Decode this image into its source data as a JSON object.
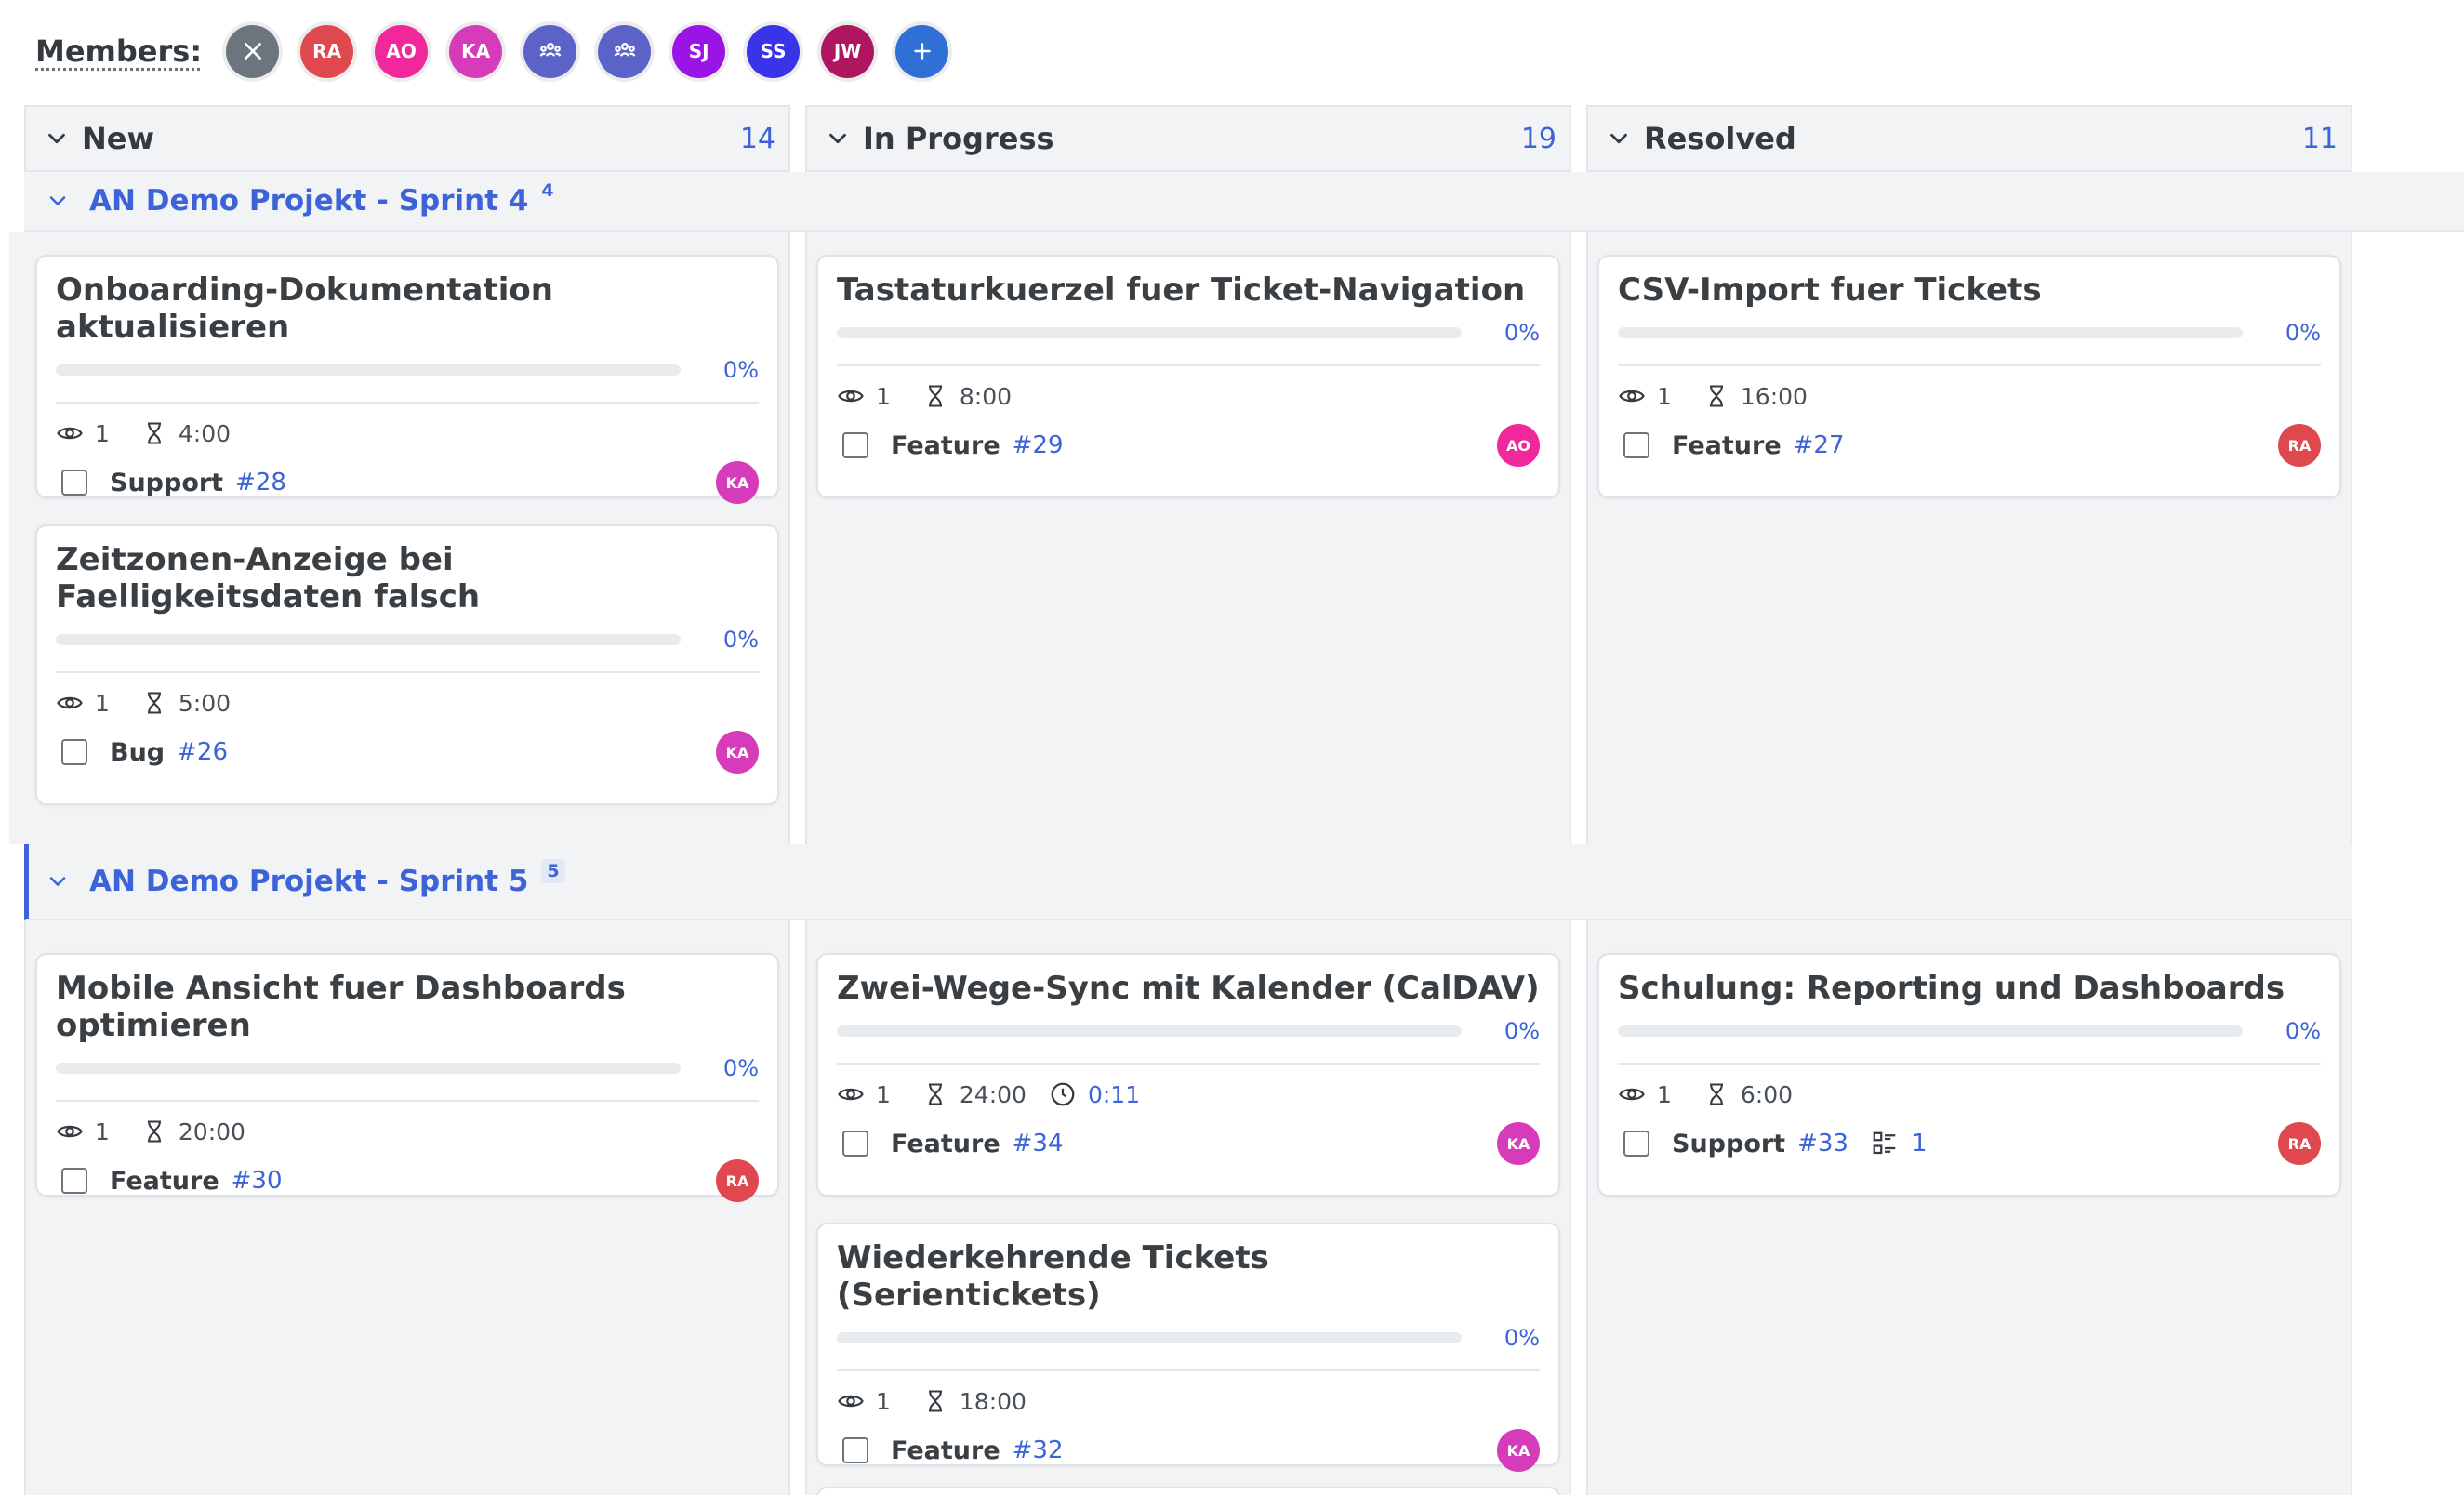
{
  "members": {
    "label": "Members:",
    "avatars": [
      {
        "initials": "",
        "icon": "close-icon",
        "color": "#6c757d"
      },
      {
        "initials": "RA",
        "color": "#e0484f"
      },
      {
        "initials": "AO",
        "color": "#f0289c"
      },
      {
        "initials": "KA",
        "color": "#d63bb9"
      },
      {
        "initials": "",
        "icon": "group-icon",
        "color": "#5b63c9"
      },
      {
        "initials": "",
        "icon": "group-icon",
        "color": "#5b63c9"
      },
      {
        "initials": "SJ",
        "color": "#9b14e6"
      },
      {
        "initials": "SS",
        "color": "#3a34e8"
      },
      {
        "initials": "JW",
        "color": "#b0155f"
      },
      {
        "initials": "",
        "icon": "plus-icon",
        "color": "#2f6fd6"
      }
    ]
  },
  "columns": [
    {
      "title": "New",
      "count": "14"
    },
    {
      "title": "In Progress",
      "count": "19"
    },
    {
      "title": "Resolved",
      "count": "11"
    }
  ],
  "swimlanes": [
    {
      "title": "AN Demo Projekt - Sprint 4",
      "count": "4"
    },
    {
      "title": "AN Demo Projekt - Sprint 5",
      "count": "5"
    }
  ],
  "cards": {
    "c28": {
      "title": "Onboarding-Dokumentation aktualisieren",
      "progress": 0,
      "progress_label": "0%",
      "watchers": "1",
      "estimate": "4:00",
      "type": "Support",
      "id": "#28",
      "assignee": "KA",
      "assignee_color": "#d63bb9"
    },
    "c26": {
      "title": "Zeitzonen-Anzeige bei Faelligkeitsdaten falsch",
      "progress": 0,
      "progress_label": "0%",
      "watchers": "1",
      "estimate": "5:00",
      "type": "Bug",
      "id": "#26",
      "assignee": "KA",
      "assignee_color": "#d63bb9"
    },
    "c29": {
      "title": "Tastaturkuerzel fuer Ticket-Navigation",
      "progress": 0,
      "progress_label": "0%",
      "watchers": "1",
      "estimate": "8:00",
      "type": "Feature",
      "id": "#29",
      "assignee": "AO",
      "assignee_color": "#f0289c"
    },
    "c27": {
      "title": "CSV-Import fuer Tickets",
      "progress": 0,
      "progress_label": "0%",
      "watchers": "1",
      "estimate": "16:00",
      "type": "Feature",
      "id": "#27",
      "assignee": "RA",
      "assignee_color": "#e0484f"
    },
    "c30": {
      "title": "Mobile Ansicht fuer Dashboards optimieren",
      "progress": 0,
      "progress_label": "0%",
      "watchers": "1",
      "estimate": "20:00",
      "type": "Feature",
      "id": "#30",
      "assignee": "RA",
      "assignee_color": "#e0484f"
    },
    "c34": {
      "title": "Zwei-Wege-Sync mit Kalender (CalDAV)",
      "progress": 0,
      "progress_label": "0%",
      "watchers": "1",
      "estimate": "24:00",
      "time_spent": "0:11",
      "type": "Feature",
      "id": "#34",
      "assignee": "KA",
      "assignee_color": "#d63bb9"
    },
    "c32": {
      "title": "Wiederkehrende Tickets (Serientickets)",
      "progress": 0,
      "progress_label": "0%",
      "watchers": "1",
      "estimate": "18:00",
      "type": "Feature",
      "id": "#32",
      "assignee": "KA",
      "assignee_color": "#d63bb9"
    },
    "c33": {
      "title": "Schulung: Reporting und Dashboards",
      "progress": 0,
      "progress_label": "0%",
      "watchers": "1",
      "estimate": "6:00",
      "type": "Support",
      "id": "#33",
      "subtasks": "1",
      "assignee": "RA",
      "assignee_color": "#e0484f"
    }
  }
}
